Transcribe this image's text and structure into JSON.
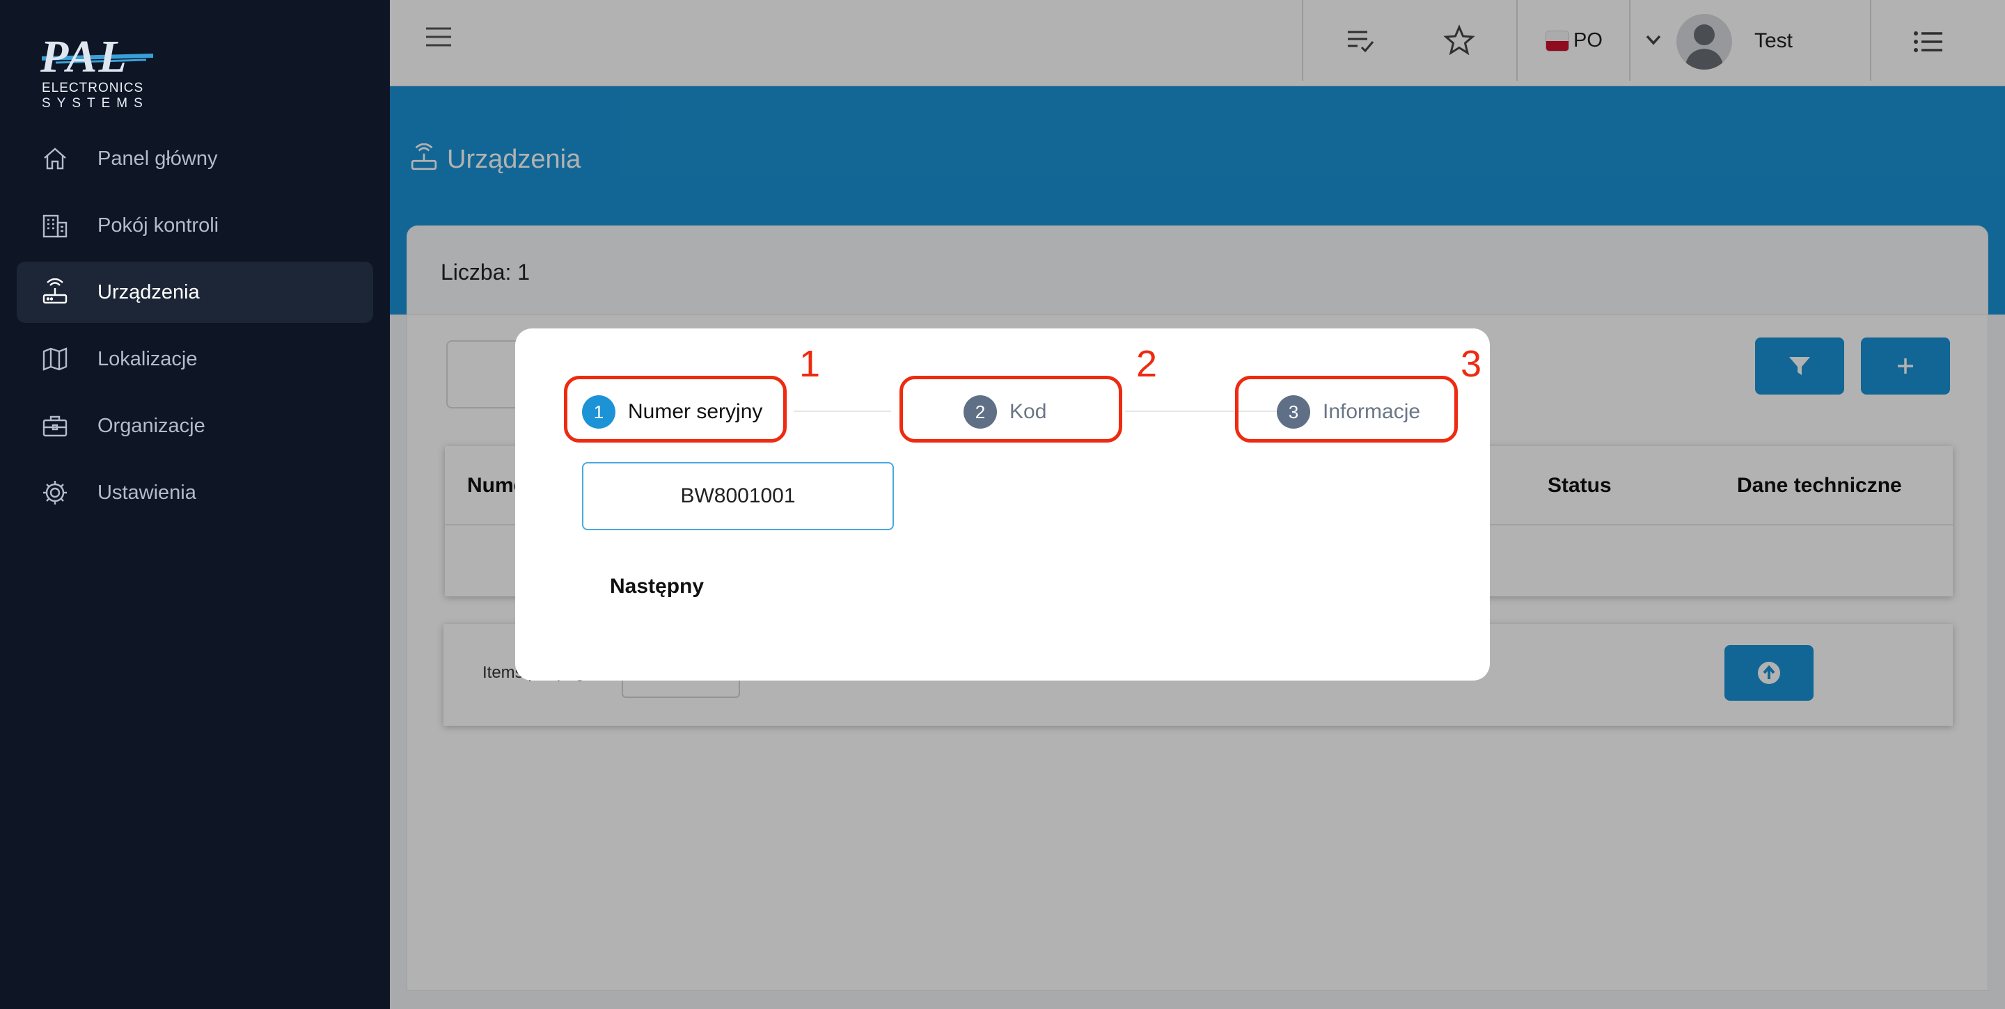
{
  "brand": {
    "name": "PAL",
    "line2": "ELECTRONICS",
    "line3": "SYSTEMS"
  },
  "sidebar": {
    "items": [
      {
        "label": "Panel główny",
        "icon": "home-icon",
        "active": false
      },
      {
        "label": "Pokój kontroli",
        "icon": "building-icon",
        "active": false
      },
      {
        "label": "Urządzenia",
        "icon": "router-icon",
        "active": true
      },
      {
        "label": "Lokalizacje",
        "icon": "map-icon",
        "active": false
      },
      {
        "label": "Organizacje",
        "icon": "briefcase-icon",
        "active": false
      },
      {
        "label": "Ustawienia",
        "icon": "gear-icon",
        "active": false
      }
    ]
  },
  "topbar": {
    "language": "PO",
    "user": "Test"
  },
  "page": {
    "title": "Urządzenia",
    "count_label": "Liczba: 1"
  },
  "table": {
    "headers": [
      "Nume",
      "Status",
      "Dane techniczne"
    ]
  },
  "pager": {
    "label": "Items per page"
  },
  "modal": {
    "steps": [
      {
        "num": "1",
        "label": "Numer seryjny",
        "state": "active",
        "annotation": "1"
      },
      {
        "num": "2",
        "label": "Kod",
        "state": "todo",
        "annotation": "2"
      },
      {
        "num": "3",
        "label": "Informacje",
        "state": "todo",
        "annotation": "3"
      }
    ],
    "serial_value": "BW8001001",
    "next_label": "Następny"
  },
  "colors": {
    "primary": "#1b93d6",
    "sidebar": "#0e1525",
    "annotation": "#ee2a10"
  }
}
